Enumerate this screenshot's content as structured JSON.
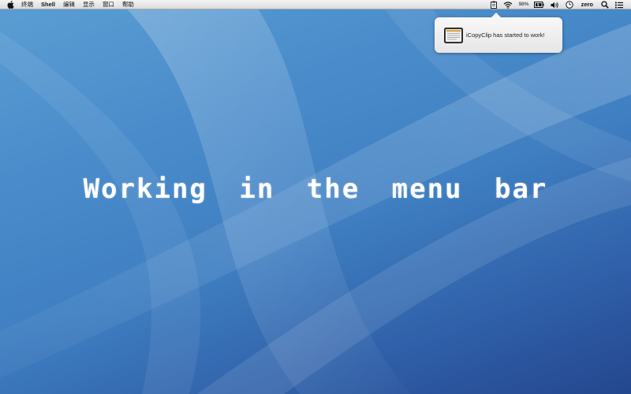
{
  "menubar": {
    "apple_icon": "apple-logo-icon",
    "items": [
      "终端",
      "Shell",
      "编辑",
      "显示",
      "窗口",
      "帮助"
    ],
    "status": {
      "clipboard_icon": "clipboard-icon",
      "wifi_icon": "wifi-icon",
      "battery_percent": "98%",
      "battery_icon": "battery-icon",
      "volume_icon": "volume-icon",
      "clock_icon": "clock-icon",
      "user_name": "zero",
      "search_icon": "search-icon",
      "list_icon": "notification-list-icon"
    }
  },
  "notification": {
    "icon": "icopyclip-app-icon",
    "message": "iCopyClip has started to work!"
  },
  "headline": "Working in the menu bar",
  "colors": {
    "desktop_top": "#5b9ed3",
    "desktop_bottom": "#24478f",
    "headline_text": "#ffffff"
  }
}
